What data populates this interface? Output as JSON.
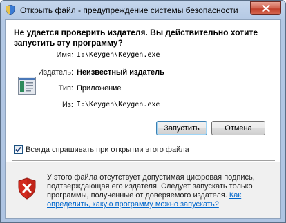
{
  "window": {
    "title": "Открыть файл - предупреждение системы безопасности"
  },
  "dialog": {
    "headline": "Не удается проверить издателя.  Вы действительно хотите запустить эту программу?",
    "fields": {
      "name_label": "Имя:",
      "name_value": "I:\\Keygen\\Keygen.exe",
      "publisher_label": "Издатель:",
      "publisher_value": "Неизвестный издатель",
      "type_label": "Тип:",
      "type_value": "Приложение",
      "from_label": "Из:",
      "from_value": "I:\\Keygen\\Keygen.exe"
    },
    "buttons": {
      "run": "Запустить",
      "cancel": "Отмена"
    },
    "checkbox": {
      "label": "Всегда спрашивать при открытии этого файла",
      "checked": true
    },
    "warning": {
      "text": "У этого файла отсутствует допустимая цифровая подпись, подтверждающая его издателя.  Следует запускать только программы, полученные от доверяемого издателя.",
      "link": "Как определить, какую программу можно запускать?"
    }
  },
  "icons": {
    "title_icon": "security-shield-icon",
    "program_icon": "application-window-icon",
    "warning_icon": "red-shield-x-icon",
    "close": "close-icon"
  },
  "colors": {
    "title_bar": "#b8cce6",
    "close_button": "#c94a36",
    "link": "#0066cc",
    "warning_shield": "#d32a1f"
  }
}
